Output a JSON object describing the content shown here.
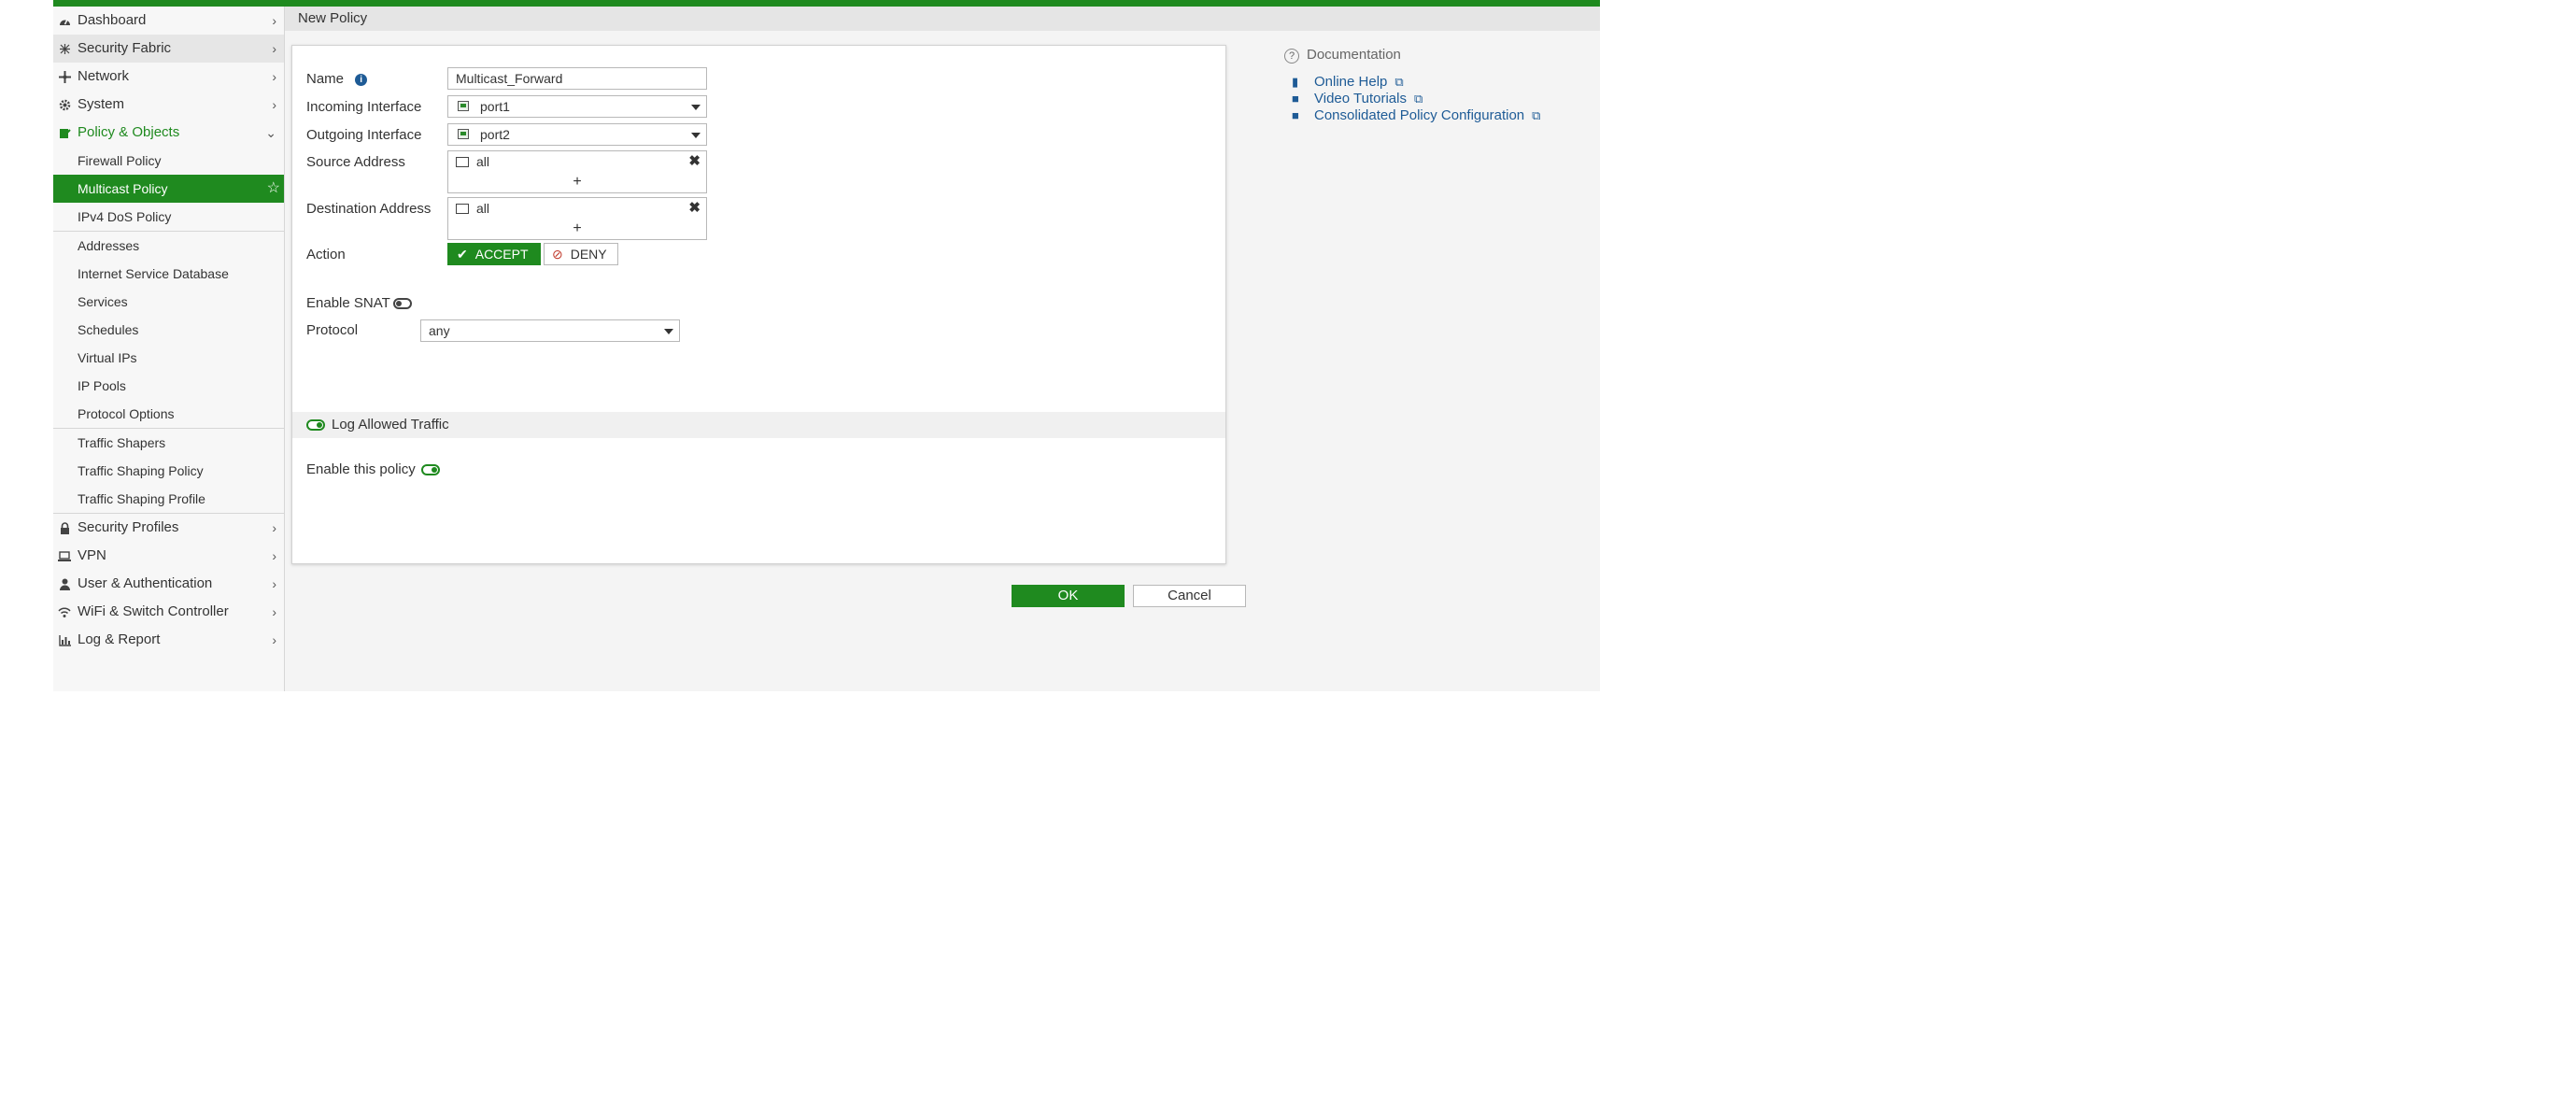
{
  "header": {
    "title": "New Policy"
  },
  "sidebar": {
    "items": [
      {
        "label": "Dashboard",
        "icon": "dashboard-icon"
      },
      {
        "label": "Security Fabric",
        "icon": "security-fabric-icon"
      },
      {
        "label": "Network",
        "icon": "network-icon"
      },
      {
        "label": "System",
        "icon": "gear-icon"
      },
      {
        "label": "Policy & Objects",
        "icon": "policy-objects-icon"
      }
    ],
    "sub_items": [
      "Firewall Policy",
      "Multicast Policy",
      "IPv4 DoS Policy",
      "Addresses",
      "Internet Service Database",
      "Services",
      "Schedules",
      "Virtual IPs",
      "IP Pools",
      "Protocol Options",
      "Traffic Shapers",
      "Traffic Shaping Policy",
      "Traffic Shaping Profile"
    ],
    "bottom_items": [
      {
        "label": "Security Profiles",
        "icon": "lock-icon"
      },
      {
        "label": "VPN",
        "icon": "laptop-icon"
      },
      {
        "label": "User & Authentication",
        "icon": "user-icon"
      },
      {
        "label": "WiFi & Switch Controller",
        "icon": "wifi-icon"
      },
      {
        "label": "Log & Report",
        "icon": "chart-icon"
      }
    ]
  },
  "form": {
    "name_label": "Name",
    "name_value": "Multicast_Forward",
    "incoming_label": "Incoming Interface",
    "incoming_value": "port1",
    "outgoing_label": "Outgoing Interface",
    "outgoing_value": "port2",
    "source_label": "Source Address",
    "source_value": "all",
    "destination_label": "Destination Address",
    "destination_value": "all",
    "plus": "+",
    "action_label": "Action",
    "accept_label": "ACCEPT",
    "deny_label": "DENY",
    "snat_label": "Enable SNAT",
    "protocol_label": "Protocol",
    "protocol_value": "any",
    "log_label": "Log Allowed Traffic",
    "enable_label": "Enable this policy"
  },
  "docs": {
    "title": "Documentation",
    "links": [
      "Online Help",
      "Video Tutorials",
      "Consolidated Policy Configuration"
    ]
  },
  "buttons": {
    "ok": "OK",
    "cancel": "Cancel"
  },
  "colors": {
    "brand": "#1f8a1f",
    "link": "#1e5b96"
  }
}
